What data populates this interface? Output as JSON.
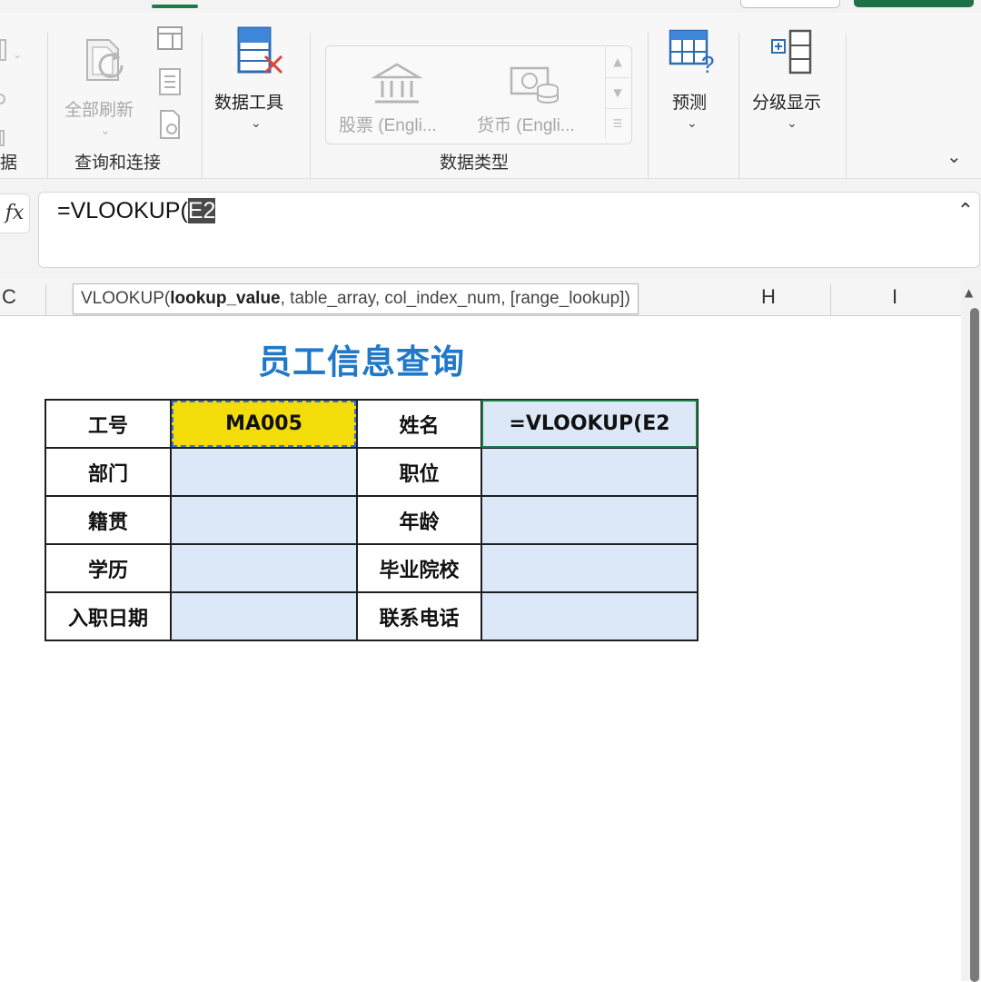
{
  "ribbon": {
    "left_partial_label": "据",
    "queries_group": {
      "refresh_all_label": "全部刷新",
      "group_label": "查询和连接"
    },
    "data_tools": {
      "label": "数据工具"
    },
    "data_types": {
      "stocks_label": "股票 (Engli...",
      "currencies_label": "货币 (Engli...",
      "group_label": "数据类型"
    },
    "forecast": {
      "label": "预测"
    },
    "outline": {
      "label": "分级显示"
    }
  },
  "formula_bar": {
    "fx_label": "fx",
    "text_prefix": "=VLOOKUP(",
    "text_selected": "E2"
  },
  "columns": [
    "C",
    "H",
    "I"
  ],
  "tooltip": {
    "func": "VLOOKUP(",
    "arg_bold": "lookup_value",
    "rest": ", table_array, col_index_num, [range_lookup])"
  },
  "sheet": {
    "title": "员工信息查询",
    "rows": [
      {
        "l1": "工号",
        "v1": "MA005",
        "l2": "姓名",
        "v2": "=VLOOKUP(E2"
      },
      {
        "l1": "部门",
        "v1": "",
        "l2": "职位",
        "v2": ""
      },
      {
        "l1": "籍贯",
        "v1": "",
        "l2": "年龄",
        "v2": ""
      },
      {
        "l1": "学历",
        "v1": "",
        "l2": "毕业院校",
        "v2": ""
      },
      {
        "l1": "入职日期",
        "v1": "",
        "l2": "联系电话",
        "v2": ""
      }
    ]
  },
  "colors": {
    "title": "#1f78c8",
    "id_cell": "#f2dd0a",
    "value_cells": "#dce8f7",
    "active_border": "#1b7a45"
  }
}
